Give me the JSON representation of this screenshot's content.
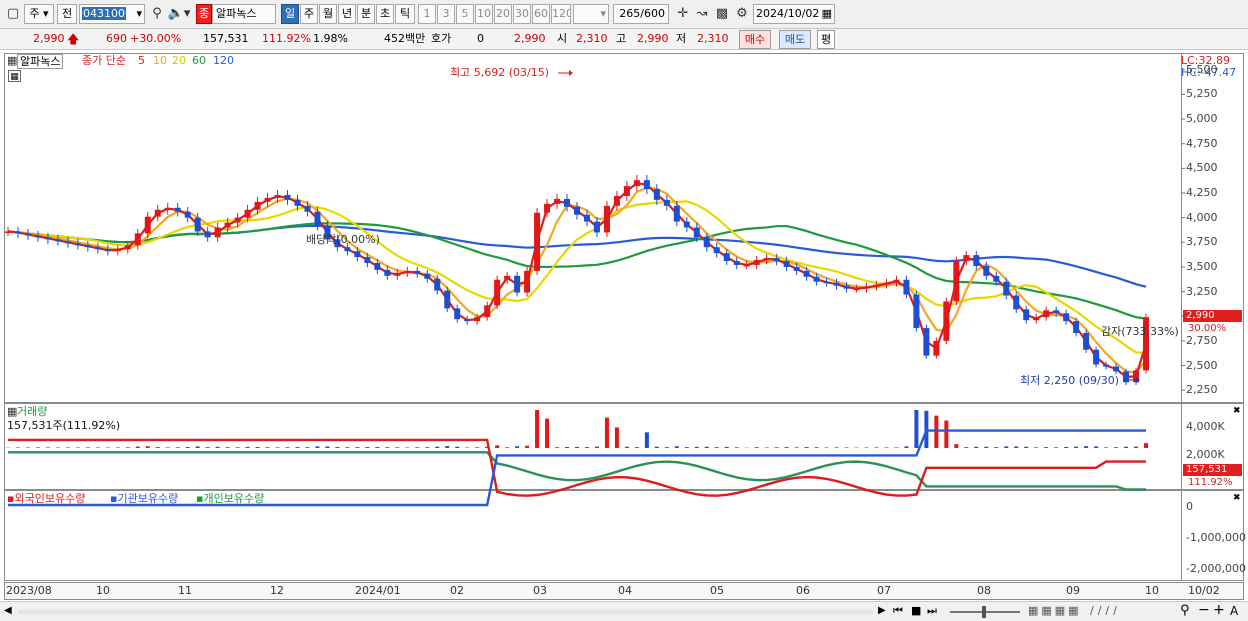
{
  "toolbar": {
    "period_selector": "주",
    "prev_label": "전",
    "code": "043100",
    "stock_badge": "종",
    "stock_name": "알파녹스",
    "periods": [
      "일",
      "주",
      "월",
      "년",
      "분",
      "초",
      "틱"
    ],
    "active_period": "일",
    "intervals": [
      "1",
      "3",
      "5",
      "10",
      "20",
      "30",
      "60",
      "120"
    ],
    "count": "265",
    "count_total": "/600",
    "date": "2024/10/02"
  },
  "quote": {
    "price": "2,990",
    "change": "690",
    "change_pct": "+30.00%",
    "volume": "157,531",
    "volume_ratio": "111.92%",
    "turnover": "1.98%",
    "amount": "452백만",
    "hoga_label": "호가",
    "hoga_value": "0",
    "hoga_price": "2,990",
    "open_label": "시",
    "open": "2,310",
    "high_label": "고",
    "high": "2,990",
    "low_label": "저",
    "low": "2,310",
    "buy": "매수",
    "sell": "매도",
    "avg": "평"
  },
  "price_panel": {
    "stock_tab": "알파녹스",
    "legend_title": "종가 단순",
    "ma_labels": [
      "5",
      "10",
      "20",
      "60",
      "120"
    ],
    "ma_colors": [
      "#d81e1e",
      "#f5a623",
      "#e8d800",
      "#1c9a3c",
      "#2b5ad6"
    ],
    "lc": "LC:32.89",
    "hc": "HC:-47.47",
    "high_annot": "최고 5,692 (03/15)",
    "low_annot": "최저 2,250 (09/30)",
    "dividend_annot": "배당락(0.00%)",
    "reduction_annot": "감자(733.33%)",
    "y_ticks": [
      "5,500",
      "5,250",
      "5,000",
      "4,750",
      "4,500",
      "4,250",
      "4,000",
      "3,750",
      "3,500",
      "3,250",
      "3,000",
      "2,750",
      "2,500",
      "2,250"
    ],
    "last_tag": "2,990",
    "last_pct_tag": "30.00%"
  },
  "volume_panel": {
    "title": "거래량",
    "value": "157,531주(111.92%)",
    "y_ticks": [
      "4,000K",
      "2,000K"
    ],
    "last_tag": "157,531",
    "last_pct_tag": "111.92%"
  },
  "holdings_panel": {
    "legend": [
      "외국인보유수량",
      "기관보유수량",
      "개인보유수량"
    ],
    "colors": [
      "#d81e1e",
      "#2b5ad6",
      "#1c9a3c"
    ],
    "y_ticks": [
      "0",
      "-1,000,000",
      "-2,000,000"
    ]
  },
  "x_ticks": [
    "2023/08",
    "10",
    "11",
    "12",
    "2024/01",
    "02",
    "03",
    "04",
    "05",
    "06",
    "07",
    "08",
    "09",
    "10",
    "10/02"
  ],
  "chart_data": {
    "type": "candlestick",
    "y_range": [
      2150,
      5650
    ],
    "close_series": [
      3860,
      3840,
      3820,
      3800,
      3780,
      3760,
      3740,
      3720,
      3700,
      3680,
      3660,
      3680,
      3720,
      3840,
      4010,
      4080,
      4100,
      4060,
      4000,
      3860,
      3800,
      3900,
      3950,
      4000,
      4080,
      4160,
      4200,
      4230,
      4180,
      4120,
      4060,
      3920,
      3780,
      3700,
      3660,
      3600,
      3540,
      3470,
      3410,
      3440,
      3460,
      3430,
      3380,
      3260,
      3080,
      2970,
      2950,
      2990,
      3110,
      3370,
      3410,
      3240,
      3460,
      4050,
      4140,
      4190,
      4110,
      4030,
      3960,
      3850,
      4120,
      4220,
      4320,
      4380,
      4290,
      4180,
      4120,
      3960,
      3900,
      3800,
      3700,
      3640,
      3560,
      3520,
      3520,
      3570,
      3590,
      3560,
      3500,
      3460,
      3400,
      3350,
      3340,
      3310,
      3280,
      3280,
      3300,
      3320,
      3340,
      3370,
      3220,
      2880,
      2600,
      2750,
      3150,
      3560,
      3620,
      3510,
      3410,
      3350,
      3210,
      3070,
      2960,
      2990,
      3060,
      3030,
      2950,
      2830,
      2660,
      2510,
      2490,
      2440,
      2330,
      2450,
      2990
    ]
  }
}
